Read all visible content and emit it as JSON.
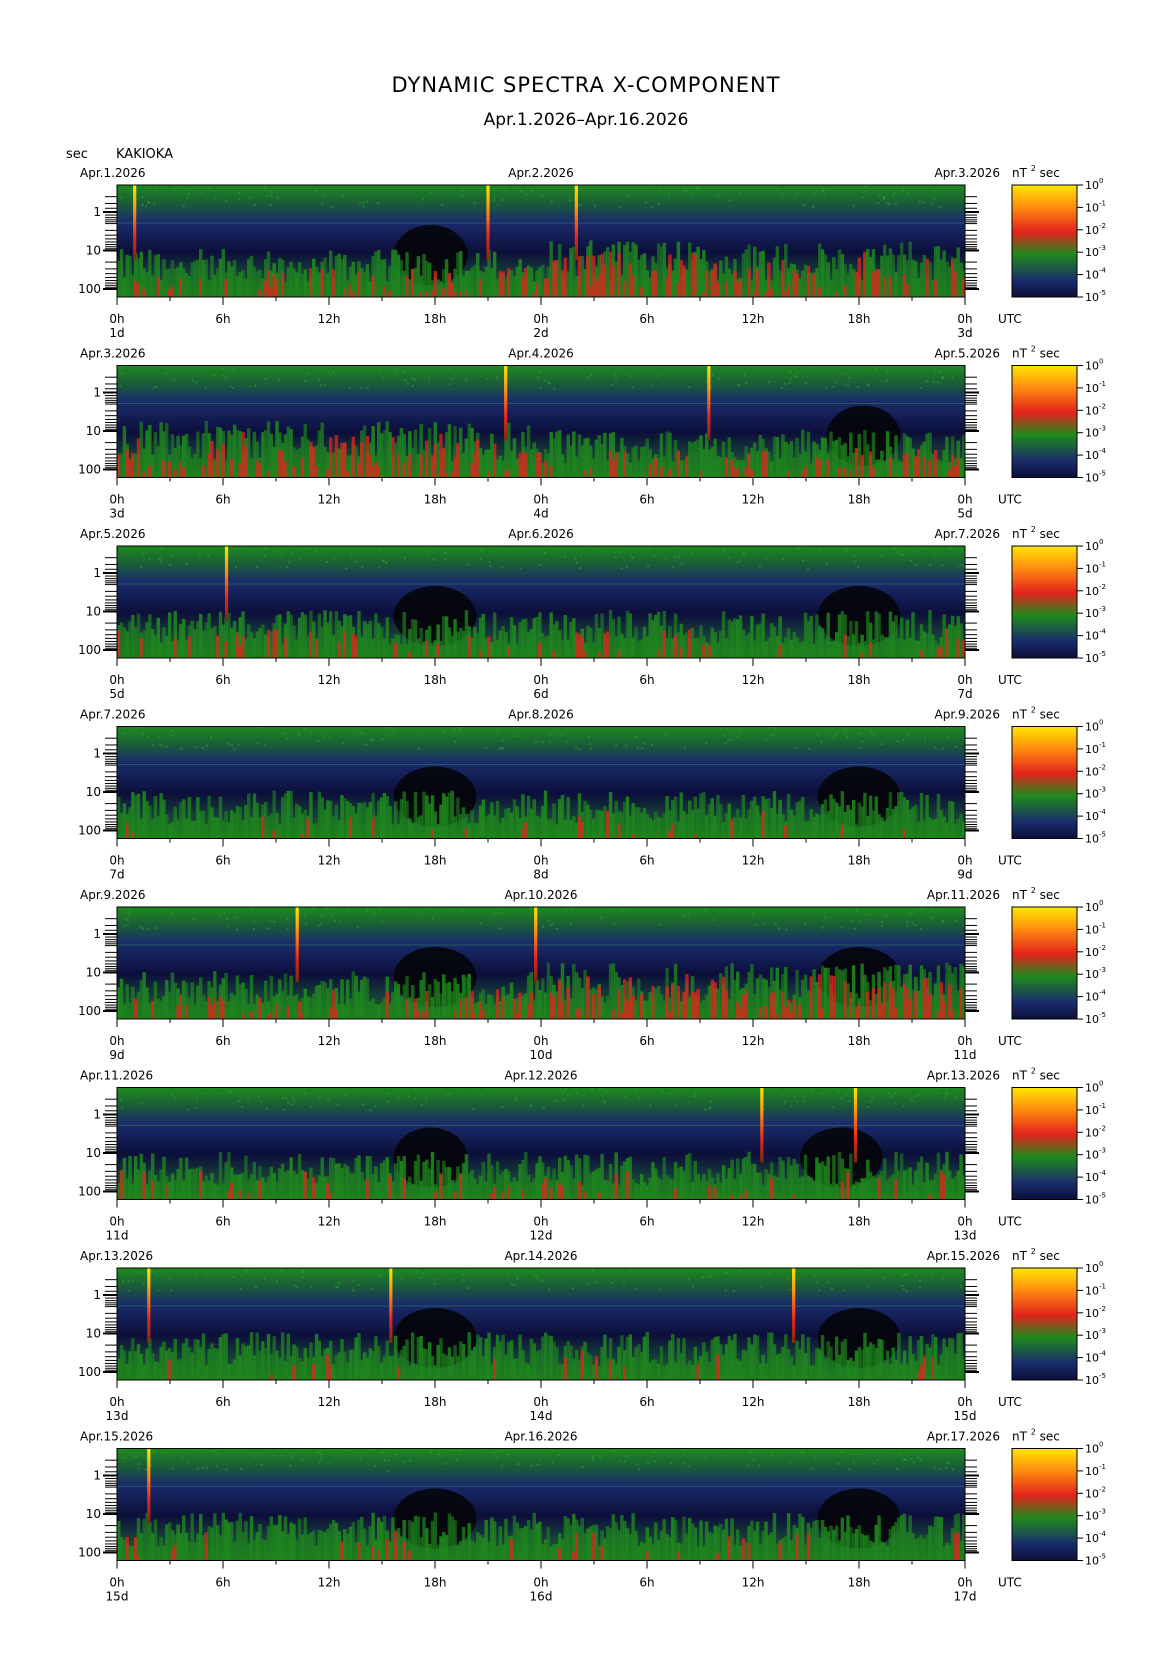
{
  "title": "DYNAMIC SPECTRA X-COMPONENT",
  "subtitle": "Apr.1.2026–Apr.16.2026",
  "y_unit": "sec",
  "station": "KAKIOKA",
  "cbar_unit_base": "nT",
  "cbar_unit_exp": "2",
  "cbar_unit_tail": "sec",
  "time_zone": "UTC",
  "colors": {
    "navy": "#0c0f3a",
    "blue": "#1a2c6c",
    "green": "#1f8a1d",
    "red": "#e3231c",
    "orange": "#ff8a10",
    "yellow": "#ffe800",
    "black": "#040406"
  },
  "chart_data": {
    "type": "heatmap",
    "description_axes": "x = time (UTC hours, 2 days per panel), y = period (sec, log scale, inverted)",
    "x_ticks": [
      "0h",
      "6h",
      "12h",
      "18h",
      "0h",
      "6h",
      "12h",
      "18h",
      "0h"
    ],
    "y_ticks": [
      "1",
      "10",
      "100"
    ],
    "y_scale": "log",
    "colorbar_ticks": [
      {
        "base": "10",
        "exp": "0"
      },
      {
        "base": "10",
        "exp": "-1"
      },
      {
        "base": "10",
        "exp": "-2"
      },
      {
        "base": "10",
        "exp": "-3"
      },
      {
        "base": "10",
        "exp": "-4"
      },
      {
        "base": "10",
        "exp": "-5"
      }
    ],
    "panels": [
      {
        "date_left": "Apr.1.2026",
        "date_mid": "Apr.2.2026",
        "date_right": "Apr.3.2026",
        "day_labels": [
          "1d",
          "2d",
          "3d"
        ],
        "spikes_h": [
          1.0,
          21.0,
          26.0
        ],
        "quiet_h": [
          [
            16,
            19.5
          ]
        ],
        "activity": "high-late"
      },
      {
        "date_left": "Apr.3.2026",
        "date_mid": "Apr.4.2026",
        "date_right": "Apr.5.2026",
        "day_labels": [
          "3d",
          "4d",
          "5d"
        ],
        "spikes_h": [
          22.0,
          33.5
        ],
        "quiet_h": [
          [
            40.5,
            44
          ]
        ],
        "activity": "high-early"
      },
      {
        "date_left": "Apr.5.2026",
        "date_mid": "Apr.6.2026",
        "date_right": "Apr.7.2026",
        "day_labels": [
          "5d",
          "6d",
          "7d"
        ],
        "spikes_h": [
          6.2
        ],
        "quiet_h": [
          [
            16,
            20
          ],
          [
            40,
            44
          ]
        ],
        "activity": "medium"
      },
      {
        "date_left": "Apr.7.2026",
        "date_mid": "Apr.8.2026",
        "date_right": "Apr.9.2026",
        "day_labels": [
          "7d",
          "8d",
          "9d"
        ],
        "spikes_h": [],
        "quiet_h": [
          [
            16,
            20
          ],
          [
            40,
            44
          ]
        ],
        "activity": "low"
      },
      {
        "date_left": "Apr.9.2026",
        "date_mid": "Apr.10.2026",
        "date_right": "Apr.11.2026",
        "day_labels": [
          "9d",
          "10d",
          "11d"
        ],
        "spikes_h": [
          10.2,
          23.7
        ],
        "quiet_h": [
          [
            16,
            20
          ],
          [
            40,
            44
          ]
        ],
        "activity": "high-late"
      },
      {
        "date_left": "Apr.11.2026",
        "date_mid": "Apr.12.2026",
        "date_right": "Apr.13.2026",
        "day_labels": [
          "11d",
          "12d",
          "13d"
        ],
        "spikes_h": [
          36.5,
          41.8
        ],
        "quiet_h": [
          [
            16,
            19.5
          ],
          [
            39,
            43
          ]
        ],
        "activity": "medium"
      },
      {
        "date_left": "Apr.13.2026",
        "date_mid": "Apr.14.2026",
        "date_right": "Apr.15.2026",
        "day_labels": [
          "13d",
          "14d",
          "15d"
        ],
        "spikes_h": [
          1.8,
          15.5,
          38.3
        ],
        "quiet_h": [
          [
            16,
            20
          ],
          [
            40,
            44
          ]
        ],
        "activity": "low"
      },
      {
        "date_left": "Apr.15.2026",
        "date_mid": "Apr.16.2026",
        "date_right": "Apr.17.2026",
        "day_labels": [
          "15d",
          "16d",
          "17d"
        ],
        "spikes_h": [
          1.8
        ],
        "quiet_h": [
          [
            16,
            20
          ],
          [
            40,
            44
          ]
        ],
        "activity": "low"
      }
    ]
  }
}
